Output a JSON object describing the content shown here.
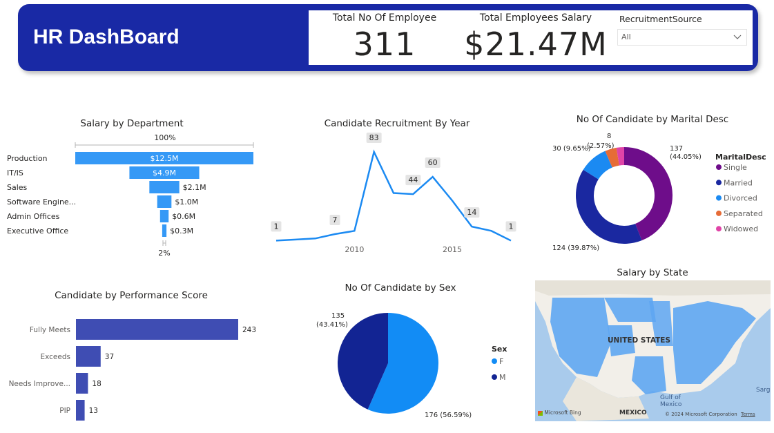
{
  "header": {
    "title": "HR DashBoard",
    "kpis": [
      {
        "label": "Total No Of Employee",
        "value": "311"
      },
      {
        "label": "Total Employees Salary",
        "value": "$21.47M"
      }
    ],
    "slicer": {
      "label": "RecruitmentSource",
      "value": "All"
    }
  },
  "colors": {
    "header_bg": "#1929a5",
    "funnel": "#3599f6",
    "line": "#1b8af2",
    "perf_bar": "#3f4db3",
    "single": "#6e0d8a",
    "married": "#1a28a0",
    "divorced": "#1b8af2",
    "separated": "#e66c37",
    "widowed": "#e044a7",
    "female": "#128cf5",
    "male": "#122493"
  },
  "funnel": {
    "title": "Salary by Department",
    "top_label": "100%",
    "bottom_label": "2%",
    "chart_data": {
      "type": "bar",
      "categories": [
        "Production",
        "IT/IS",
        "Sales",
        "Software Engine...",
        "Admin Offices",
        "Executive Office"
      ],
      "values": [
        12.5,
        4.9,
        2.1,
        1.0,
        0.6,
        0.3
      ],
      "value_labels": [
        "$12.5M",
        "$4.9M",
        "$2.1M",
        "$1.0M",
        "$0.6M",
        "$0.3M"
      ],
      "title": "Salary by Department"
    }
  },
  "recruitment": {
    "title": "Candidate Recruitment By Year",
    "chart_data": {
      "type": "line",
      "x": [
        2006,
        2007,
        2008,
        2009,
        2010,
        2011,
        2012,
        2013,
        2014,
        2015,
        2016,
        2017,
        2018
      ],
      "values": [
        1,
        2,
        3,
        7,
        10,
        83,
        45,
        44,
        60,
        38,
        14,
        10,
        1
      ],
      "labeled_points": [
        {
          "index": 0,
          "text": "1"
        },
        {
          "index": 3,
          "text": "7"
        },
        {
          "index": 5,
          "text": "83"
        },
        {
          "index": 7,
          "text": "44"
        },
        {
          "index": 8,
          "text": "60"
        },
        {
          "index": 10,
          "text": "14"
        },
        {
          "index": 12,
          "text": "1"
        }
      ],
      "x_ticks": [
        "2010",
        "2015"
      ],
      "ylim": [
        0,
        90
      ],
      "title": "Candidate Recruitment By Year"
    }
  },
  "marital": {
    "title": "No Of Candidate by Marital Desc",
    "legend_title": "MaritalDesc",
    "chart_data": {
      "type": "pie",
      "categories": [
        "Single",
        "Married",
        "Divorced",
        "Separated",
        "Widowed"
      ],
      "values": [
        137,
        124,
        30,
        12,
        8
      ],
      "labels": [
        "137\n(44.05%)",
        "124 (39.87%)",
        "30 (9.65%)",
        "(2.57%)",
        "8"
      ],
      "legend": "right"
    }
  },
  "performance": {
    "title": "Candidate by Performance Score",
    "chart_data": {
      "type": "bar",
      "categories": [
        "Fully Meets",
        "Exceeds",
        "Needs Improve...",
        "PIP"
      ],
      "values": [
        243,
        37,
        18,
        13
      ],
      "title": "Candidate by Performance Score"
    }
  },
  "sex": {
    "title": "No Of Candidate by Sex",
    "legend_title": "Sex",
    "chart_data": {
      "type": "pie",
      "categories": [
        "F",
        "M"
      ],
      "values": [
        176,
        135
      ],
      "labels_f": "176 (56.59%)",
      "labels_m_1": "135",
      "labels_m_2": "(43.41%)",
      "legend": "right"
    }
  },
  "map": {
    "title": "Salary by State",
    "country_label": "UNITED STATES",
    "gulf_label_1": "Gulf of",
    "gulf_label_2": "Mexico",
    "mexico_label": "MEXICO",
    "bing_label": "Microsoft Bing",
    "copyright": "© 2024 Microsoft Corporation",
    "terms": "Terms",
    "sargasso": "Sarga"
  }
}
